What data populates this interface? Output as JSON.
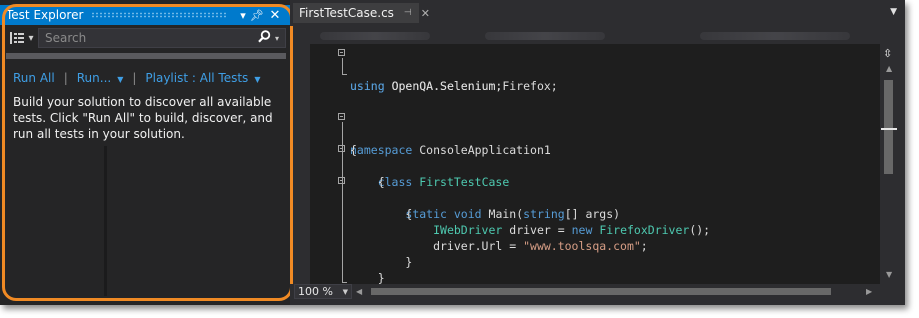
{
  "test_explorer": {
    "title": "Test Explorer",
    "pin_icon": "pin-icon",
    "close_icon": "close-icon",
    "search": {
      "placeholder": "Search"
    },
    "actions": {
      "run_all": "Run All",
      "separator": "|",
      "run": "Run...",
      "playlist": "Playlist : All Tests"
    },
    "message": "Build your solution to discover all available tests. Click \"Run All\" to build, discover, and run all tests in your solution."
  },
  "editor": {
    "tab": {
      "label": "FirstTestCase.cs"
    },
    "zoom": "100 %",
    "code": [
      {
        "text": "using OpenQA.Selenium;"
      },
      {
        "text": "using OpenQA.Selenium.Firefox;"
      },
      {
        "text": ""
      },
      {
        "text": ""
      },
      {
        "text": "namespace ConsoleApplication1"
      },
      {
        "text": "{"
      },
      {
        "text": "    class FirstTestCase"
      },
      {
        "text": "    {"
      },
      {
        "text": "        static void Main(string[] args)"
      },
      {
        "text": "        {"
      },
      {
        "text": "            IWebDriver driver = new FirefoxDriver();"
      },
      {
        "text": "            driver.Url = \"www.toolsqa.com\";"
      },
      {
        "text": "        }"
      },
      {
        "text": "    }"
      },
      {
        "text": "}"
      }
    ]
  },
  "colors": {
    "accent": "#007acc",
    "highlight": "#f08a24",
    "link": "#3f9fe6",
    "keyword": "#569cd6",
    "type": "#4ec9b0",
    "string": "#d69d85"
  }
}
